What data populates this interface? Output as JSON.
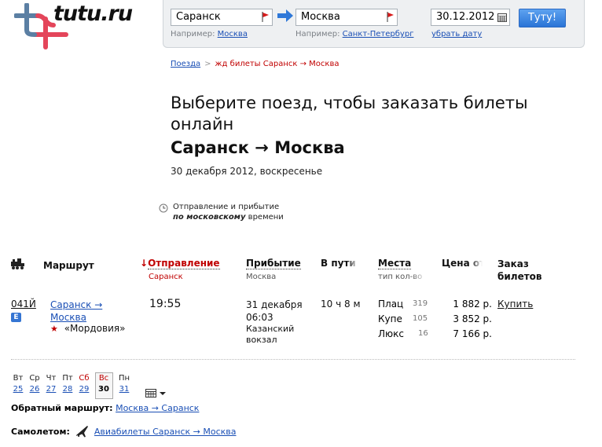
{
  "logo": {
    "text": "tutu.ru"
  },
  "search": {
    "from_value": "Саранск",
    "to_value": "Москва",
    "date_value": "30.12.2012",
    "submit_label": "Туту!",
    "from_hint_label": "Например:",
    "from_hint_link": "Москва",
    "to_hint_label": "Например:",
    "to_hint_link": "Санкт-Петербург",
    "date_clear_link": "убрать дату",
    "flag_color": "#d81b1b",
    "arrow_color": "#2f78d8"
  },
  "breadcrumb": {
    "root": "Поезда",
    "separator": ">",
    "current": "жд билеты Саранск → Москва"
  },
  "heading": "Выберите поезд, чтобы заказать билеты онлайн",
  "route_title": "Саранск → Москва",
  "date_line": "30 декабря 2012, воскресенье",
  "timezone_note": {
    "line1": "Отправление и прибытие",
    "line2_emph": "по московскому",
    "line2_rest": " времени"
  },
  "table": {
    "headers": {
      "route": "Маршрут",
      "departure": "Отправление",
      "departure_sub": "Саранск",
      "arrival": "Прибытие",
      "arrival_sub": "Москва",
      "duration": "В пути",
      "seats": "Места",
      "seats_sub": "тип кол-во",
      "price": "Цена от",
      "order_line1": "Заказ",
      "order_line2": "билетов"
    },
    "rows": [
      {
        "train_number": "041Й",
        "badge": "E",
        "route_from": "Саранск →",
        "route_to": "Москва",
        "train_name": "«Мордовия»",
        "departure_time": "19:55",
        "arrival_date": "31 декабря",
        "arrival_time": "06:03",
        "arrival_station_1": "Казанский",
        "arrival_station_2": "вокзал",
        "duration": "10 ч 8 м",
        "seats": [
          {
            "type": "Плац",
            "count": "319",
            "price": "1 882 р."
          },
          {
            "type": "Купе",
            "count": "105",
            "price": "3 852 р."
          },
          {
            "type": "Люкс",
            "count": "16",
            "price": "7 166 р."
          }
        ],
        "buy_label": "Купить"
      }
    ]
  },
  "calendar": {
    "days": [
      {
        "name": "Вт",
        "date": "25",
        "weekend": false,
        "selected": false
      },
      {
        "name": "Ср",
        "date": "26",
        "weekend": false,
        "selected": false
      },
      {
        "name": "Чт",
        "date": "27",
        "weekend": false,
        "selected": false
      },
      {
        "name": "Пт",
        "date": "28",
        "weekend": false,
        "selected": false
      },
      {
        "name": "Сб",
        "date": "29",
        "weekend": true,
        "selected": false
      },
      {
        "name": "Вс",
        "date": "30",
        "weekend": true,
        "selected": true
      },
      {
        "name": "Пн",
        "date": "31",
        "weekend": false,
        "selected": false
      }
    ]
  },
  "return_route": {
    "label": "Обратный маршрут:",
    "link": "Москва → Саранск"
  },
  "by_plane": {
    "label": "Самолетом:",
    "link": "Авиабилеты Саранск → Москва"
  }
}
